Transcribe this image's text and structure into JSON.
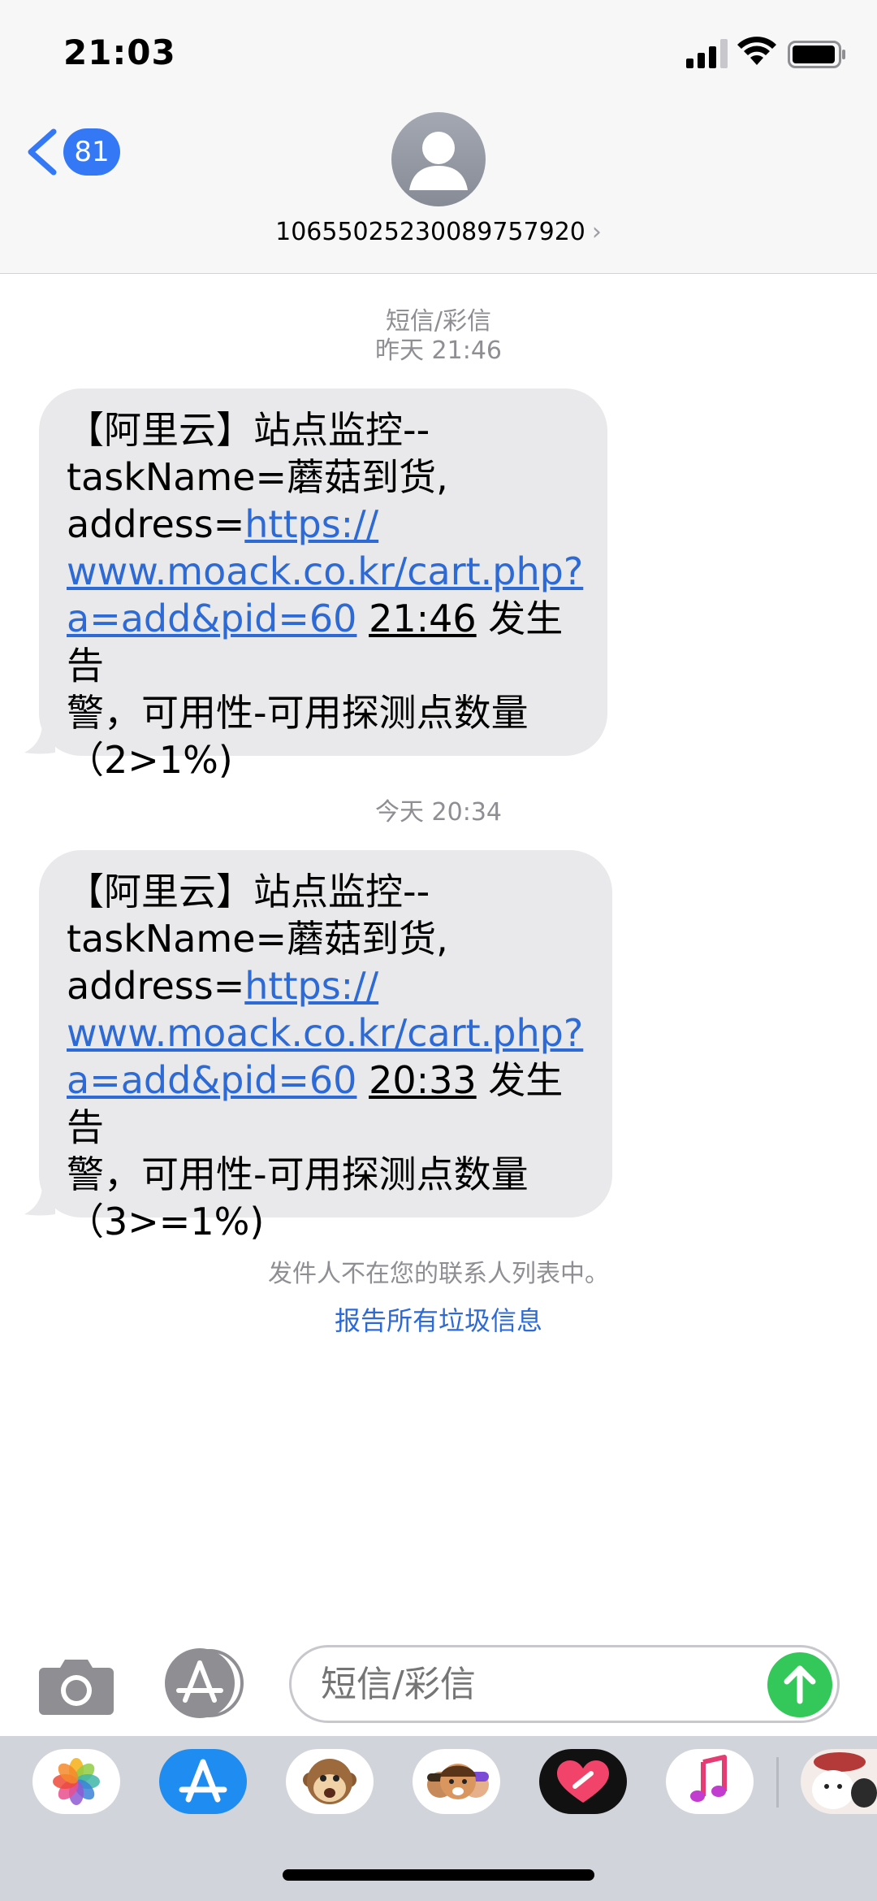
{
  "status_bar": {
    "time": "21:03"
  },
  "header": {
    "back_count": "81",
    "contact": "10655025230089757920",
    "contact_chevron": "›"
  },
  "conversation": {
    "service_label": "短信/彩信",
    "messages": [
      {
        "timestamp": "昨天 21:46",
        "line1": "【阿里云】站点监控--",
        "line2": "taskName=蘑菇到货,",
        "address_prefix": "address=",
        "link_part1": "https://",
        "link_part2": "www.moack.co.kr/cart.php?",
        "link_part3": "a=add&pid=60",
        "time": "21:46",
        "after_time": " 发生告",
        "line6": "警，可用性-可用探测点数量",
        "line7": "（2>1%)"
      },
      {
        "timestamp": "今天 20:34",
        "line1": "【阿里云】站点监控--",
        "line2": "taskName=蘑菇到货,",
        "address_prefix": "address=",
        "link_part1": "https://",
        "link_part2": "www.moack.co.kr/cart.php?",
        "link_part3": "a=add&pid=60",
        "time": "20:33",
        "after_time": " 发生告",
        "line6": "警，可用性-可用探测点数量",
        "line7": "（3>=1%)"
      }
    ],
    "notice": "发件人不在您的联系人列表中。",
    "report_link": "报告所有垃圾信息"
  },
  "composer": {
    "placeholder": "短信/彩信"
  },
  "icons": {
    "back": "chevron-left-icon",
    "avatar": "person-icon",
    "camera": "camera-icon",
    "apps": "app-store-icon",
    "send": "arrow-up-icon"
  },
  "colors": {
    "accent": "#3478f6",
    "bubble": "#e9e9eb",
    "send": "#34c759",
    "link": "#2d6ad6"
  }
}
